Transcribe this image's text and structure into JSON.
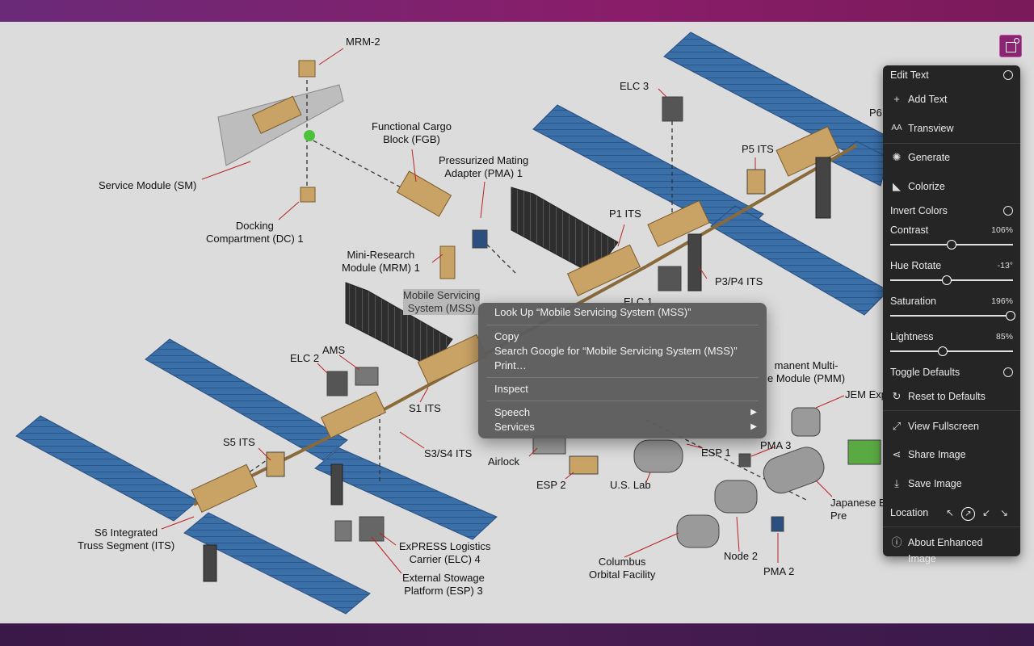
{
  "diagram": {
    "labels": {
      "mrm2": "MRM-2",
      "service_module": "Service Module (SM)",
      "docking_compartment": "Docking\nCompartment (DC) 1",
      "fgb": "Functional Cargo\nBlock (FGB)",
      "pma1": "Pressurized Mating\nAdapter (PMA) 1",
      "mrm1": "Mini-Research\nModule (MRM) 1",
      "mss": "Mobile Servicing\nSystem (MSS)",
      "elc3": "ELC 3",
      "p6": "P6",
      "p5": "P5 ITS",
      "p1": "P1 ITS",
      "elc1": "ELC 1",
      "p3p4": "P3/P4 ITS",
      "ams": "AMS",
      "elc2": "ELC 2",
      "s1": "S1 ITS",
      "s5": "S5 ITS",
      "s3s4": "S3/S4 ITS",
      "s6": "S6 Integrated\nTruss Segment (ITS)",
      "elc4": "ExPRESS Logistics\nCarrier (ELC) 4",
      "esp3": "External Stowage\nPlatform (ESP) 3",
      "pmm": "manent Multi-\ne Module (PMM)",
      "jem": "JEM Exp",
      "airlock": "Airlock",
      "esp2": "ESP 2",
      "esp1": "ESP 1",
      "pma3": "PMA 3",
      "us_lab": "U.S. Lab",
      "japanese": "Japanese E\nPre",
      "columbus": "Columbus\nOrbital Facility",
      "node2": "Node 2",
      "pma2": "PMA 2"
    }
  },
  "context_menu": {
    "lookup": "Look Up “Mobile Servicing System (MSS)”",
    "copy": "Copy",
    "search": "Search Google for “Mobile Servicing System (MSS)”",
    "print": "Print…",
    "inspect": "Inspect",
    "speech": "Speech",
    "services": "Services",
    "submenu_arrow": "▶"
  },
  "panel": {
    "edit_text": "Edit Text",
    "add_text": "Add Text",
    "transview": "Transview",
    "generate": "Generate",
    "colorize": "Colorize",
    "invert_colors": "Invert Colors",
    "contrast": {
      "label": "Contrast",
      "value": "106%",
      "level": 0.5
    },
    "hue_rotate": {
      "label": "Hue Rotate",
      "value": "-13°",
      "level": 0.46
    },
    "saturation": {
      "label": "Saturation",
      "value": "196%",
      "level": 0.98
    },
    "lightness": {
      "label": "Lightness",
      "value": "85%",
      "level": 0.43
    },
    "toggle_defaults": "Toggle Defaults",
    "reset_defaults": "Reset to Defaults",
    "view_fullscreen": "View Fullscreen",
    "share_image": "Share Image",
    "save_image": "Save Image",
    "location": "Location",
    "about": "About Enhanced Image",
    "icons": {
      "add_text": "plus-icon",
      "transview": "translate-icon",
      "generate": "sparkle-icon",
      "colorize": "palette-icon",
      "reset": "reset-icon",
      "fullscreen": "expand-icon",
      "share": "share-icon",
      "save": "download-icon",
      "about": "info-icon"
    }
  },
  "colors": {
    "panel_bg": "#252526",
    "menu_bg": "#5c5c5c",
    "accent": "#8b2472",
    "solar_array": "#3a6ea5",
    "truss": "#c8a060"
  }
}
